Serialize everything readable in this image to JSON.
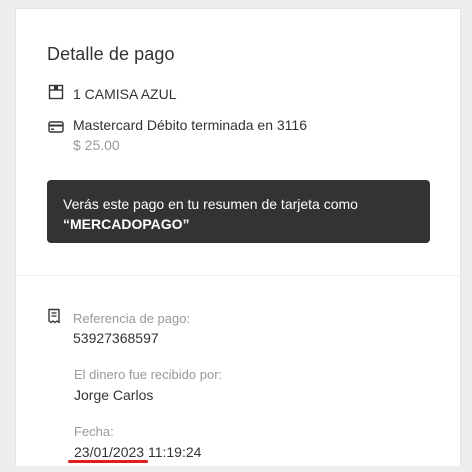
{
  "title": "Detalle de pago",
  "item": {
    "icon": "package-icon",
    "label": "1 CAMISA AZUL"
  },
  "payment": {
    "icon": "credit-card-icon",
    "method": "Mastercard Débito terminada en 3116",
    "amount": "$ 25.00"
  },
  "notice": {
    "text": "Verás este pago en tu resumen de tarjeta como",
    "merchant": "“MERCADOPAGO”"
  },
  "details": {
    "icon": "receipt-icon",
    "reference_label": "Referencia de pago:",
    "reference_value": "53927368597",
    "recipient_label": "El dinero fue recibido por:",
    "recipient_value": "Jorge Carlos",
    "date_label": "Fecha:",
    "date": "23/01/2023",
    "time": "11:19:24"
  },
  "colors": {
    "background": "#ededed",
    "card": "#ffffff",
    "notice_bg": "#333333",
    "text": "#333333",
    "muted": "#999999",
    "underline": "#e01e1e"
  }
}
